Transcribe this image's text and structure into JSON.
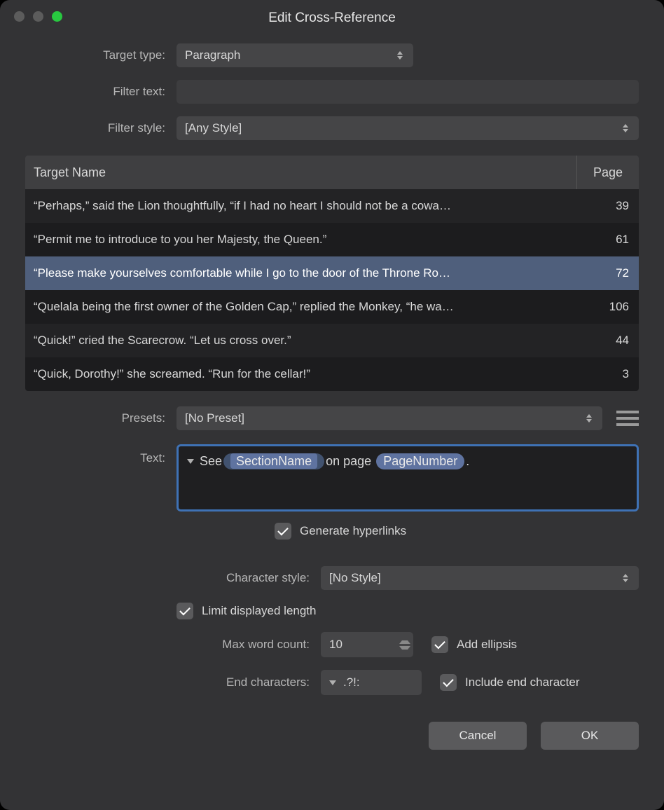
{
  "window": {
    "title": "Edit Cross-Reference"
  },
  "labels": {
    "target_type": "Target type:",
    "filter_text": "Filter text:",
    "filter_style": "Filter style:",
    "presets": "Presets:",
    "text": "Text:",
    "character_style": "Character style:",
    "max_word_count": "Max word count:",
    "end_characters": "End characters:"
  },
  "target_type": {
    "value": "Paragraph"
  },
  "filter_text": {
    "value": ""
  },
  "filter_style": {
    "value": "[Any Style]"
  },
  "table": {
    "columns": {
      "name": "Target Name",
      "page": "Page"
    },
    "rows": [
      {
        "name": "“Perhaps,” said the Lion thoughtfully, “if I had no heart I should not be a cowa…",
        "page": "39",
        "selected": false
      },
      {
        "name": "“Permit me to introduce to you her Majesty, the Queen.”",
        "page": "61",
        "selected": false
      },
      {
        "name": "“Please make yourselves comfortable while I go to the door of the Throne Ro…",
        "page": "72",
        "selected": true
      },
      {
        "name": "“Quelala being the first owner of the Golden Cap,” replied the Monkey, “he wa…",
        "page": "106",
        "selected": false
      },
      {
        "name": "“Quick!” cried the Scarecrow. “Let us cross over.”",
        "page": "44",
        "selected": false
      },
      {
        "name": "“Quick, Dorothy!” she screamed. “Run for the cellar!”",
        "page": "3",
        "selected": false
      }
    ]
  },
  "presets": {
    "value": "[No Preset]"
  },
  "text_template": {
    "prefix": "See",
    "token1": "SectionName",
    "mid": "on page",
    "token2": "PageNumber",
    "suffix": "."
  },
  "generate_hyperlinks": {
    "label": "Generate hyperlinks",
    "checked": true
  },
  "character_style": {
    "value": "[No Style]"
  },
  "limit_length": {
    "label": "Limit displayed length",
    "checked": true
  },
  "max_word_count": {
    "value": "10"
  },
  "add_ellipsis": {
    "label": "Add ellipsis",
    "checked": true
  },
  "end_characters": {
    "value": ".?!:"
  },
  "include_end_char": {
    "label": "Include end character",
    "checked": true
  },
  "buttons": {
    "cancel": "Cancel",
    "ok": "OK"
  }
}
